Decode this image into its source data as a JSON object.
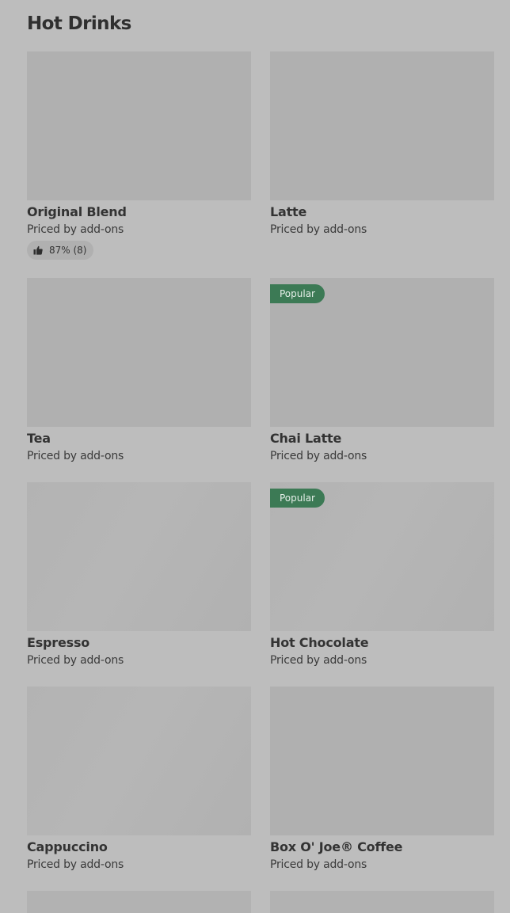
{
  "section": {
    "title": "Hot Drinks"
  },
  "items": [
    {
      "name": "Original Blend",
      "price": "Priced by add-ons",
      "badge": "",
      "rating": "87% (8)"
    },
    {
      "name": "Latte",
      "price": "Priced by add-ons",
      "badge": "",
      "rating": ""
    },
    {
      "name": "Tea",
      "price": "Priced by add-ons",
      "badge": "",
      "rating": ""
    },
    {
      "name": "Chai Latte",
      "price": "Priced by add-ons",
      "badge": "Popular",
      "rating": ""
    },
    {
      "name": "Espresso",
      "price": "Priced by add-ons",
      "badge": "",
      "rating": ""
    },
    {
      "name": "Hot Chocolate",
      "price": "Priced by add-ons",
      "badge": "Popular",
      "rating": ""
    },
    {
      "name": "Cappuccino",
      "price": "Priced by add-ons",
      "badge": "",
      "rating": ""
    },
    {
      "name": "Box O' Joe® Coffee",
      "price": "Priced by add-ons",
      "badge": "",
      "rating": ""
    }
  ],
  "icons": {
    "rating": "thumbs-up-icon"
  },
  "colors": {
    "background": "#bdbdbd",
    "image_placeholder": "#b0b0b0",
    "badge": "#3c7a55"
  }
}
